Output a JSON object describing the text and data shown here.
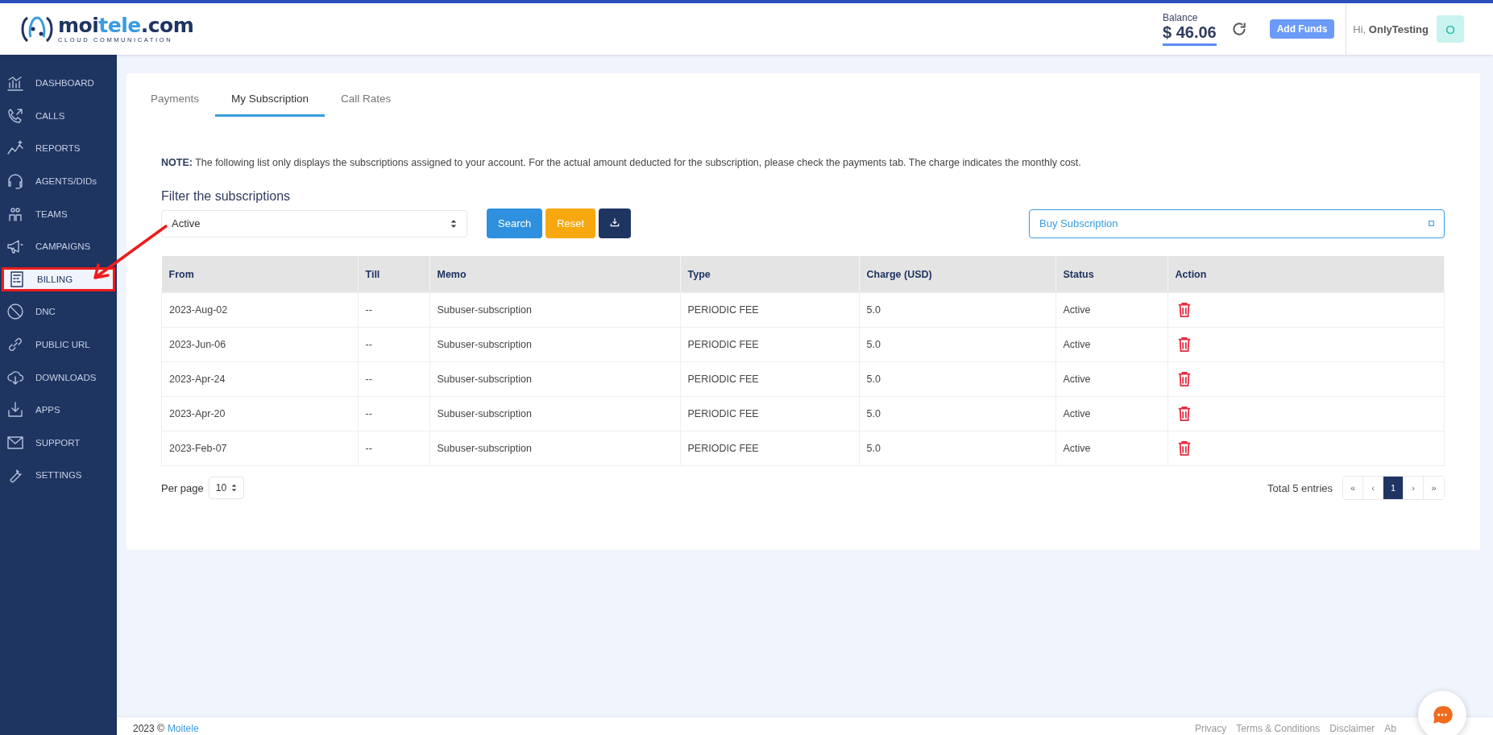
{
  "header": {
    "logo": {
      "name_start": "moi",
      "name_highlight": "tele",
      "name_end": ".com",
      "tagline": "CLOUD COMMUNICATION"
    },
    "balance_label": "Balance",
    "balance": "$ 46.06",
    "add_funds": "Add Funds",
    "greeting": "Hi, **OnlyTesting**",
    "avatar": "O"
  },
  "sidebar": {
    "items": [
      {
        "label": "DASHBOARD",
        "selected": false,
        "annotated": false
      },
      {
        "label": "CALLS",
        "selected": false,
        "annotated": false
      },
      {
        "label": "REPORTS",
        "selected": false,
        "annotated": false
      },
      {
        "label": "AGENTS/DIDs",
        "selected": false,
        "annotated": false
      },
      {
        "label": "TEAMS",
        "selected": false,
        "annotated": false
      },
      {
        "label": "CAMPAIGNS",
        "selected": false,
        "annotated": false
      },
      {
        "label": "BILLING",
        "selected": true,
        "annotated": true
      },
      {
        "label": "DNC",
        "selected": false,
        "annotated": false
      },
      {
        "label": "PUBLIC URL",
        "selected": false,
        "annotated": false
      },
      {
        "label": "DOWNLOADS",
        "selected": false,
        "annotated": false
      },
      {
        "label": "APPS",
        "selected": false,
        "annotated": false
      },
      {
        "label": "SUPPORT",
        "selected": false,
        "annotated": false
      },
      {
        "label": "SETTINGS",
        "selected": false,
        "annotated": false
      }
    ]
  },
  "tabs": [
    {
      "label": "Payments",
      "selected": false
    },
    {
      "label": "My Subscription",
      "selected": true
    },
    {
      "label": "Call Rates",
      "selected": false
    }
  ],
  "note": "**NOTE:** The following list only displays the subscriptions assigned to your account. For the actual amount deducted for the subscription, please check the payments tab. The charge indicates the monthly cost.",
  "filter": {
    "title": "Filter the subscriptions",
    "status": "Active",
    "search": "Search",
    "reset": "Reset",
    "buy": "Buy Subscription"
  },
  "table": {
    "columns": [
      "From",
      "Till",
      "Memo",
      "Type",
      "Charge (USD)",
      "Status",
      "Action"
    ],
    "rows": [
      [
        "2023-Aug-02",
        "--",
        "Subuser-subscription",
        "PERIODIC FEE",
        "5.0",
        "Active"
      ],
      [
        "2023-Jun-06",
        "--",
        "Subuser-subscription",
        "PERIODIC FEE",
        "5.0",
        "Active"
      ],
      [
        "2023-Apr-24",
        "--",
        "Subuser-subscription",
        "PERIODIC FEE",
        "5.0",
        "Active"
      ],
      [
        "2023-Apr-20",
        "--",
        "Subuser-subscription",
        "PERIODIC FEE",
        "5.0",
        "Active"
      ],
      [
        "2023-Feb-07",
        "--",
        "Subuser-subscription",
        "PERIODIC FEE",
        "5.0",
        "Active"
      ]
    ]
  },
  "pagination": {
    "per_page_label": "Per page",
    "per_page": "10",
    "total": "Total 5 entries",
    "pages": [
      {
        "label": "«",
        "selected": false
      },
      {
        "label": "‹",
        "selected": false
      },
      {
        "label": "1",
        "selected": true
      },
      {
        "label": "›",
        "selected": false
      },
      {
        "label": "»",
        "selected": false
      }
    ]
  },
  "footer": {
    "copyright": "2023 ©",
    "company": "Moitele",
    "links": [
      "Privacy",
      "Terms & Conditions",
      "Disclaimer",
      "Ab"
    ]
  }
}
